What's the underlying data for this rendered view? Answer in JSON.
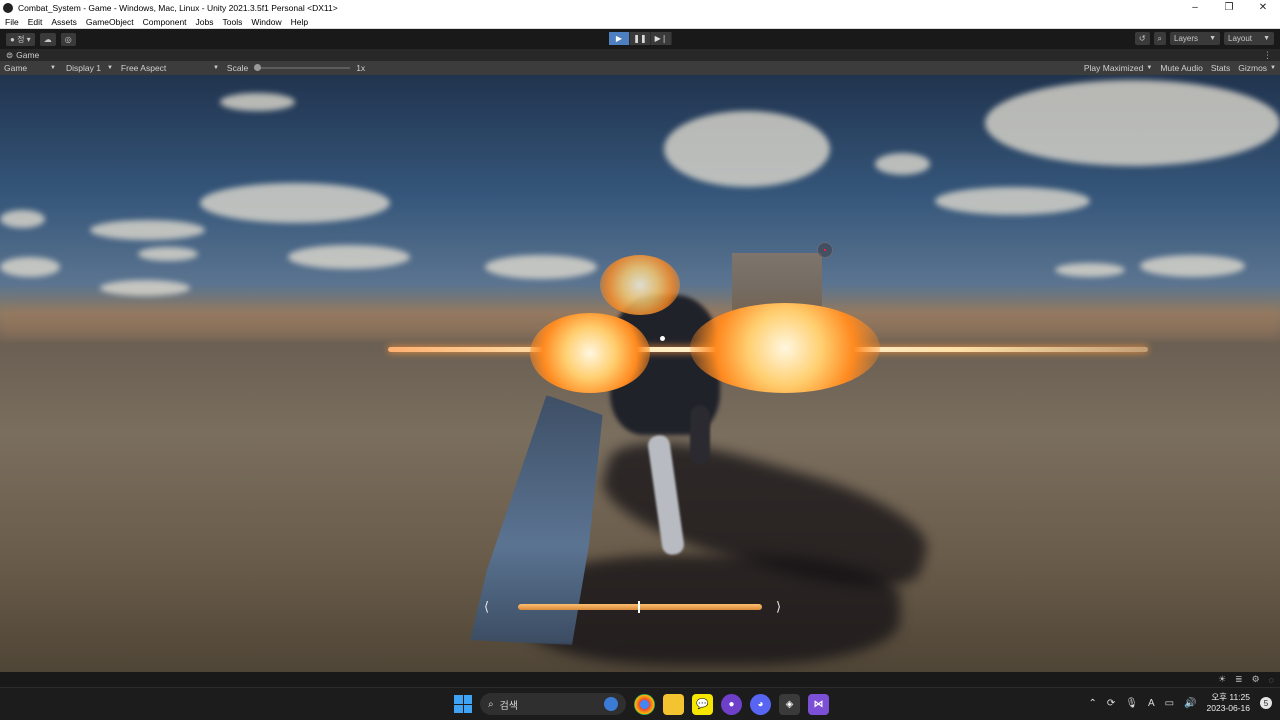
{
  "window": {
    "title": "Combat_System - Game - Windows, Mac, Linux - Unity 2021.3.5f1 Personal <DX11>",
    "minimize": "–",
    "maximize": "❐",
    "close": "✕"
  },
  "menu": [
    "File",
    "Edit",
    "Assets",
    "GameObject",
    "Component",
    "Jobs",
    "Tools",
    "Window",
    "Help"
  ],
  "toolbar": {
    "account_label": "정 ▾",
    "layers_label": "Layers",
    "layout_label": "Layout",
    "play_state": "playing"
  },
  "game_tab": {
    "label": "Game"
  },
  "game_bar": {
    "view_mode": "Game",
    "display": "Display 1",
    "aspect": "Free Aspect",
    "scale_label": "Scale",
    "scale_value": "1x",
    "play_maximized": "Play Maximized",
    "mute_audio": "Mute Audio",
    "stats": "Stats",
    "gizmos": "Gizmos"
  },
  "hud": {
    "stamina_fraction": 1.0,
    "left_arrow": "⟨",
    "right_arrow": "⟩"
  },
  "taskbar": {
    "search_label": "검색",
    "time": "오후 11:25",
    "date": "2023-06-16",
    "ime_label": "A",
    "notification_count": "5"
  },
  "colors": {
    "play_active": "#4d7fc1",
    "beam": "#ffe6b0",
    "stamina": "#e8a050"
  }
}
